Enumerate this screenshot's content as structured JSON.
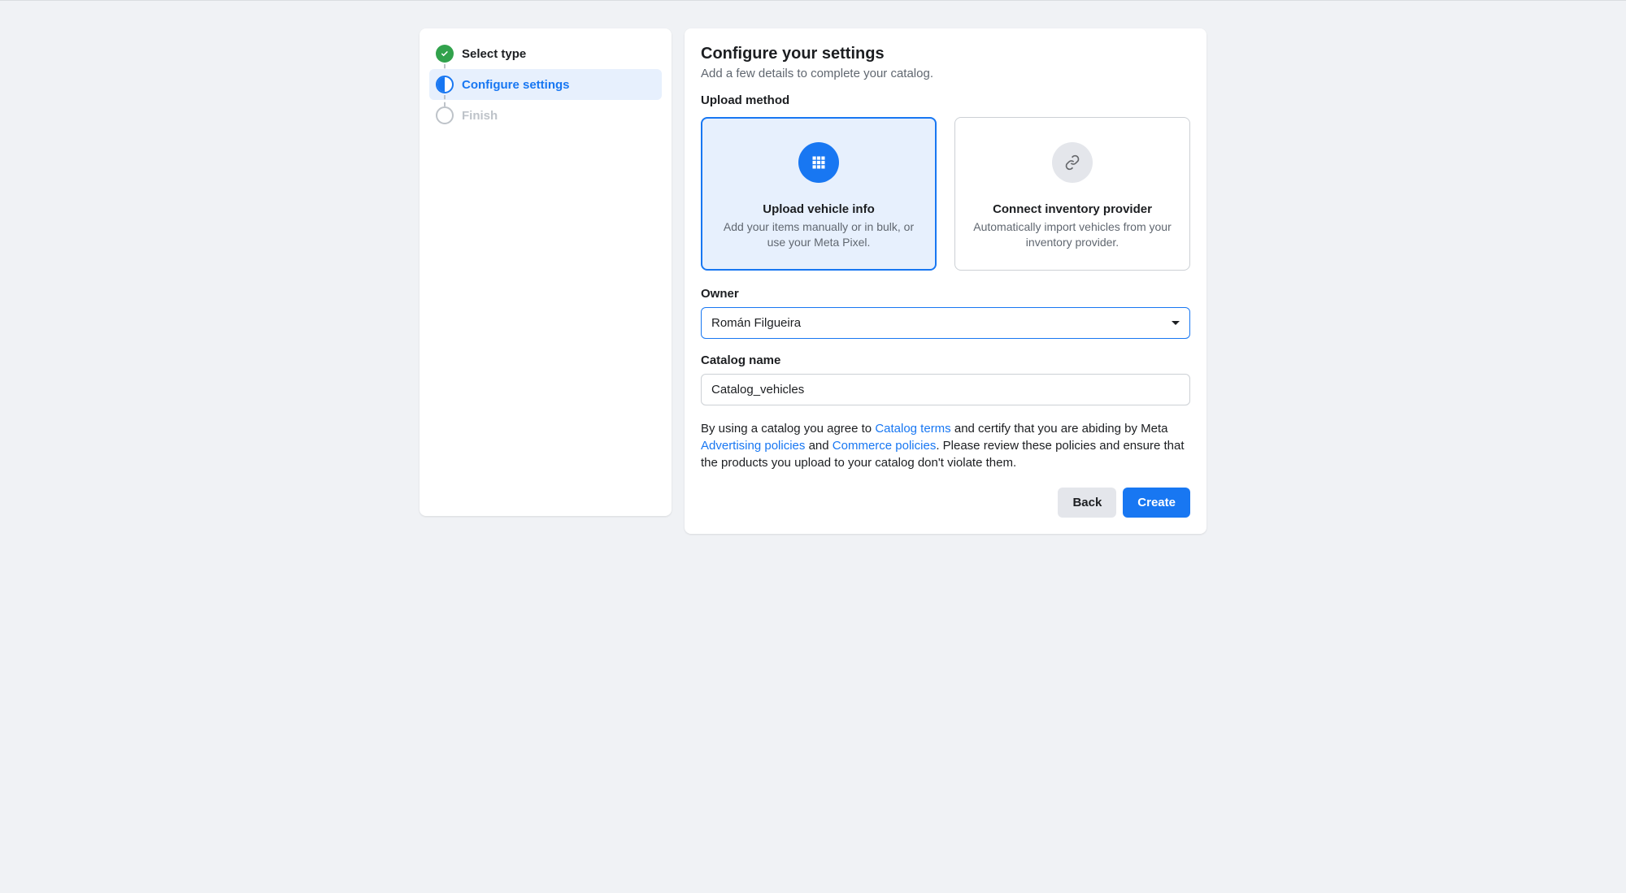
{
  "sidebar": {
    "steps": [
      {
        "label": "Select type",
        "state": "completed"
      },
      {
        "label": "Configure settings",
        "state": "current"
      },
      {
        "label": "Finish",
        "state": "pending"
      }
    ]
  },
  "main": {
    "title": "Configure your settings",
    "subtitle": "Add a few details to complete your catalog.",
    "upload_method_heading": "Upload method",
    "options": [
      {
        "title": "Upload vehicle info",
        "description": "Add your items manually or in bulk, or use your Meta Pixel.",
        "icon": "grid-icon",
        "selected": true
      },
      {
        "title": "Connect inventory provider",
        "description": "Automatically import vehicles from your inventory provider.",
        "icon": "link-icon",
        "selected": false
      }
    ],
    "owner_label": "Owner",
    "owner_value": "Román Filgueira",
    "catalog_name_label": "Catalog name",
    "catalog_name_value": "Catalog_vehicles",
    "disclaimer": {
      "pre": "By using a catalog you agree to ",
      "link1": "Catalog terms",
      "mid1": " and certify that you are abiding by Meta ",
      "link2": "Advertising policies",
      "mid2": " and ",
      "link3": "Commerce policies",
      "post": ". Please review these policies and ensure that the products you upload to your catalog don't violate them."
    },
    "back_label": "Back",
    "create_label": "Create"
  }
}
